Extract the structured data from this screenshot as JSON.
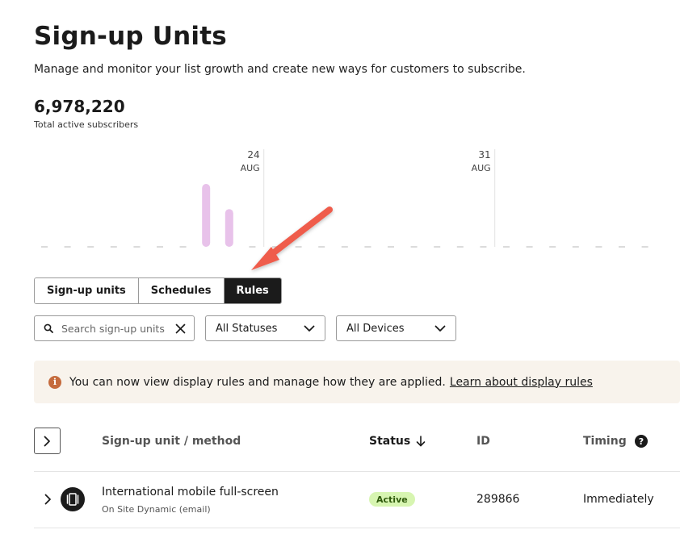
{
  "page": {
    "title": "Sign-up Units",
    "subtitle": "Manage and monitor your list growth and create new ways for customers to subscribe."
  },
  "kpi": {
    "value": "6,978,220",
    "label": "Total active subscribers"
  },
  "chart_data": {
    "type": "bar",
    "markers": [
      {
        "day": "24",
        "month": "AUG"
      },
      {
        "day": "31",
        "month": "AUG"
      }
    ],
    "bar_color": "#e8c2ea",
    "values": [
      0,
      0,
      0,
      0,
      0,
      0,
      0,
      1,
      0.6,
      0,
      0,
      0,
      0,
      0,
      0,
      0,
      0,
      0,
      0,
      0,
      0,
      0,
      0,
      0,
      0,
      0,
      0
    ],
    "marker_positions": [
      9.5,
      19.5
    ]
  },
  "tabs": [
    {
      "label": "Sign-up units",
      "active": false
    },
    {
      "label": "Schedules",
      "active": false
    },
    {
      "label": "Rules",
      "active": true
    }
  ],
  "filters": {
    "search_placeholder": "Search sign-up units",
    "status_selected": "All Statuses",
    "device_selected": "All Devices"
  },
  "banner": {
    "text": "You can now view display rules and manage how they are applied.",
    "link": "Learn about display rules"
  },
  "table": {
    "columns": {
      "name": "Sign-up unit / method",
      "status": "Status",
      "id": "ID",
      "timing": "Timing"
    },
    "rows": [
      {
        "name": "International mobile full-screen",
        "method": "On Site Dynamic (email)",
        "status": "Active",
        "id": "289866",
        "timing": "Immediately"
      }
    ]
  },
  "colors": {
    "accent_dark": "#1b1b1b",
    "active_badge": "#d7f5b1",
    "banner_bg": "#f8f3ec",
    "info_icon": "#c56b3d",
    "annotation_arrow": "#ef5b4c"
  }
}
